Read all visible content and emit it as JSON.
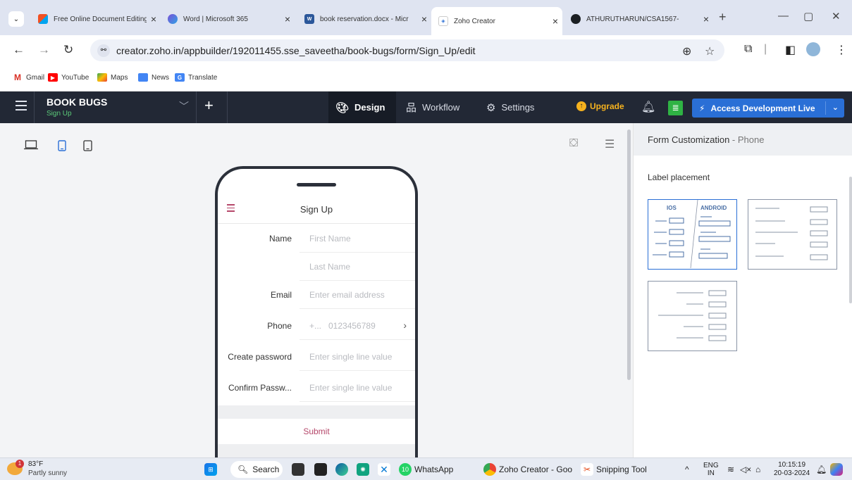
{
  "browser": {
    "tabs": [
      {
        "title": "Free Online Document Editing",
        "active": false
      },
      {
        "title": "Word | Microsoft 365",
        "active": false
      },
      {
        "title": "book reservation.docx - Micr",
        "active": false
      },
      {
        "title": "Zoho Creator",
        "active": true
      },
      {
        "title": "ATHURUTHARUN/CSA1567-",
        "active": false
      }
    ],
    "url": "creator.zoho.in/appbuilder/192011455.sse_saveetha/book-bugs/form/Sign_Up/edit",
    "bookmarks": [
      "Gmail",
      "YouTube",
      "Maps",
      "News",
      "Translate"
    ]
  },
  "app": {
    "name": "BOOK BUGS",
    "subtitle": "Sign Up",
    "nav_tabs": [
      "Design",
      "Workflow",
      "Settings"
    ],
    "active_tab": "Design",
    "upgrade_label": "Upgrade",
    "access_label": "Access Development Live"
  },
  "form": {
    "title": "Sign Up",
    "fields": [
      {
        "label": "Name",
        "placeholder": "First Name"
      },
      {
        "label": "",
        "placeholder": "Last Name"
      },
      {
        "label": "Email",
        "placeholder": "Enter email address"
      },
      {
        "label": "Phone",
        "placeholder": "+...   0123456789"
      },
      {
        "label": "Create password",
        "placeholder": "Enter single line value"
      },
      {
        "label": "Confirm Passw...",
        "placeholder": "Enter single line value"
      }
    ],
    "submit_label": "Submit"
  },
  "panel": {
    "title": "Form Customization",
    "title_suffix": " - Phone",
    "section": "Label placement",
    "ios_label": "IOS",
    "android_label": "ANDROID"
  },
  "taskbar": {
    "temperature": "83°F",
    "condition": "Partly sunny",
    "weather_badge": "1",
    "search_label": "Search",
    "whatsapp_badge": "10",
    "apps": [
      "WhatsApp",
      "Zoho Creator - Goo",
      "Snipping Tool"
    ],
    "lang": "ENG",
    "region": "IN",
    "time": "10:15:19",
    "date": "20-03-2024"
  },
  "colors": {
    "header_bg": "#222835",
    "accent": "#2a6fd6",
    "form_accent": "#b5476a",
    "live_green": "#5ccb79"
  }
}
